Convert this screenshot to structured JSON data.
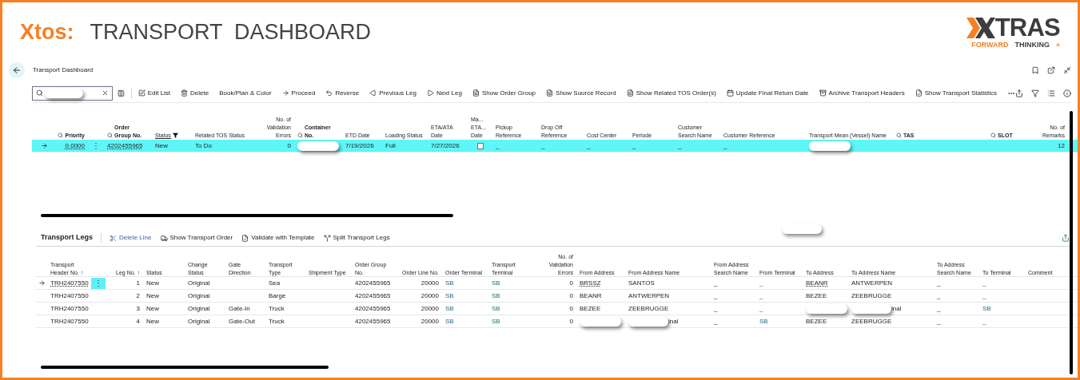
{
  "header": {
    "brand": "Xtos:",
    "title": "TRANSPORT  DASHBOARD",
    "logo": {
      "word": "TRAS",
      "tagline_1": "FORWARD",
      "tagline_2": "THINKING",
      "chevrons": "»"
    }
  },
  "page": {
    "title": "Transport Dashboard"
  },
  "actions": [
    "Edit List",
    "Delete",
    "Book/Plan & Color",
    "Proceed",
    "Reverse",
    "Previous Leg",
    "Next Leg",
    "Show Order Group",
    "Show Source Record",
    "Show Related TOS Order(s)",
    "Update Final Return Date",
    "Archive Transport Headers",
    "Show Transport Statistics"
  ],
  "header_table": {
    "columns": [
      {
        "label": "Priority",
        "searchable": true,
        "filtered": false,
        "kind": "link_number"
      },
      {
        "label": "Order\nGroup No.",
        "searchable": true,
        "filtered": false,
        "kind": "link"
      },
      {
        "label": "Status",
        "searchable": false,
        "filtered": true,
        "kind": "text"
      },
      {
        "label": "Related TOS Status",
        "searchable": false,
        "filtered": false,
        "kind": "text"
      },
      {
        "label": "No. of\nValidation\nErrors",
        "searchable": false,
        "filtered": false,
        "kind": "number"
      },
      {
        "label": "Container\nNo.",
        "searchable": true,
        "filtered": false,
        "kind": "text"
      },
      {
        "label": "ETD Date",
        "searchable": false,
        "filtered": false,
        "kind": "text"
      },
      {
        "label": "Loading Status",
        "searchable": false,
        "filtered": false,
        "kind": "text"
      },
      {
        "label": "ETA/ATA\nDate",
        "searchable": false,
        "filtered": false,
        "kind": "text"
      },
      {
        "label": "Ma...\nETA...\nDate",
        "searchable": false,
        "filtered": false,
        "kind": "checkbox"
      },
      {
        "label": "Pickup\nReference",
        "searchable": false,
        "filtered": false,
        "kind": "text"
      },
      {
        "label": "Drop Off\nReference",
        "searchable": false,
        "filtered": false,
        "kind": "text"
      },
      {
        "label": "Cost Center",
        "searchable": false,
        "filtered": false,
        "kind": "text"
      },
      {
        "label": "Periode",
        "searchable": false,
        "filtered": false,
        "kind": "text"
      },
      {
        "label": "Customer\nSearch Name",
        "searchable": false,
        "filtered": false,
        "kind": "text"
      },
      {
        "label": "Customer Reference",
        "searchable": false,
        "filtered": false,
        "kind": "text"
      },
      {
        "label": "Transport Mean (Vessel) Name",
        "searchable": false,
        "filtered": false,
        "kind": "text"
      },
      {
        "label": "TAS",
        "searchable": true,
        "filtered": false,
        "kind": "text"
      },
      {
        "label": "SLOT",
        "searchable": true,
        "filtered": false,
        "kind": "text"
      },
      {
        "label": "No. of\nRemarks",
        "searchable": false,
        "filtered": false,
        "kind": "number"
      }
    ],
    "rows": [
      {
        "selected": true,
        "menu": "⋮",
        "cells": [
          "0.0000",
          "4202455965",
          "New",
          "To Do",
          "0",
          {
            "redacted": true
          },
          "7/19/2026",
          "Full",
          "7/27/2026",
          false,
          "_",
          "_",
          "_",
          "_",
          "_",
          "_",
          {
            "redacted": true
          },
          null,
          null,
          "12"
        ]
      }
    ]
  },
  "legs": {
    "title": "Transport Legs",
    "actions": [
      {
        "label": "Delete Line",
        "highlighted": true
      },
      {
        "label": "Show Transport Order",
        "highlighted": false
      },
      {
        "label": "Validate with Template",
        "highlighted": false
      },
      {
        "label": "Split Transport Legs",
        "highlighted": false
      }
    ],
    "columns": [
      {
        "label": "Transport\nHeader No. ↑",
        "kind": "link"
      },
      {
        "label": "Leg No. ↑",
        "kind": "number"
      },
      {
        "label": "Status",
        "kind": "text"
      },
      {
        "label": "Change\nStatus",
        "kind": "text"
      },
      {
        "label": "Gate\nDirection",
        "kind": "text"
      },
      {
        "label": "Transport\nType",
        "kind": "text"
      },
      {
        "label": "Shipment Type",
        "kind": "text"
      },
      {
        "label": "Order Group\nNo.",
        "kind": "text"
      },
      {
        "label": "Order Line No.",
        "kind": "number"
      },
      {
        "label": "Order Terminal",
        "kind": "terminal"
      },
      {
        "label": "Transport\nTerminal",
        "kind": "terminal"
      },
      {
        "label": "No. of\nValidation\nErrors",
        "kind": "number"
      },
      {
        "label": "From Address",
        "kind": "link"
      },
      {
        "label": "From Address Name",
        "kind": "text"
      },
      {
        "label": "From Address\nSearch Name",
        "kind": "text"
      },
      {
        "label": "From Terminal",
        "kind": "terminal"
      },
      {
        "label": "To Address",
        "kind": "link"
      },
      {
        "label": "To Address Name",
        "kind": "text"
      },
      {
        "label": "To Address\nSearch Name",
        "kind": "text"
      },
      {
        "label": "To Terminal",
        "kind": "terminal"
      },
      {
        "label": "Comment",
        "kind": "text"
      }
    ],
    "rows": [
      {
        "selected": true,
        "menu": "⋮",
        "cells": [
          "TRH2407550",
          "1",
          "New",
          "Original",
          null,
          "Sea",
          null,
          "4202455965",
          "20000",
          "SB",
          "SB",
          "0",
          "BRSSZ",
          "SANTOS",
          "_",
          "_",
          "BEANR",
          "ANTWERPEN",
          "_",
          "_",
          null
        ]
      },
      {
        "selected": false,
        "cells": [
          "TRH2407550",
          "2",
          "New",
          "Original",
          null,
          "Barge",
          null,
          "4202455965",
          "20000",
          "SB",
          "SB",
          "0",
          "BEANR",
          "ANTWERPEN",
          "_",
          "_",
          "BEZEE",
          "ZEEBRUGGE",
          "_",
          "_",
          null
        ]
      },
      {
        "selected": false,
        "cells": [
          "TRH2407550",
          "3",
          "New",
          "Original",
          "Gate-In",
          "Truck",
          null,
          "4202455965",
          "20000",
          "SB",
          "SB",
          "0",
          "BEZEE",
          "ZEEBRUGGE",
          "_",
          "_",
          {
            "redacted": true
          },
          {
            "redacted": true,
            "tail": "inal"
          },
          "_",
          "SB",
          null
        ]
      },
      {
        "selected": false,
        "cells": [
          "TRH2407550",
          "4",
          "New",
          "Original",
          "Gate-Out",
          "Truck",
          null,
          "4202455965",
          "20000",
          "SB",
          "SB",
          "0",
          {
            "redacted": true
          },
          {
            "redacted": true,
            "tail": "inal"
          },
          "_",
          "SB",
          "BEZEE",
          "ZEEBRUGGE",
          "_",
          "_",
          null
        ]
      }
    ]
  }
}
